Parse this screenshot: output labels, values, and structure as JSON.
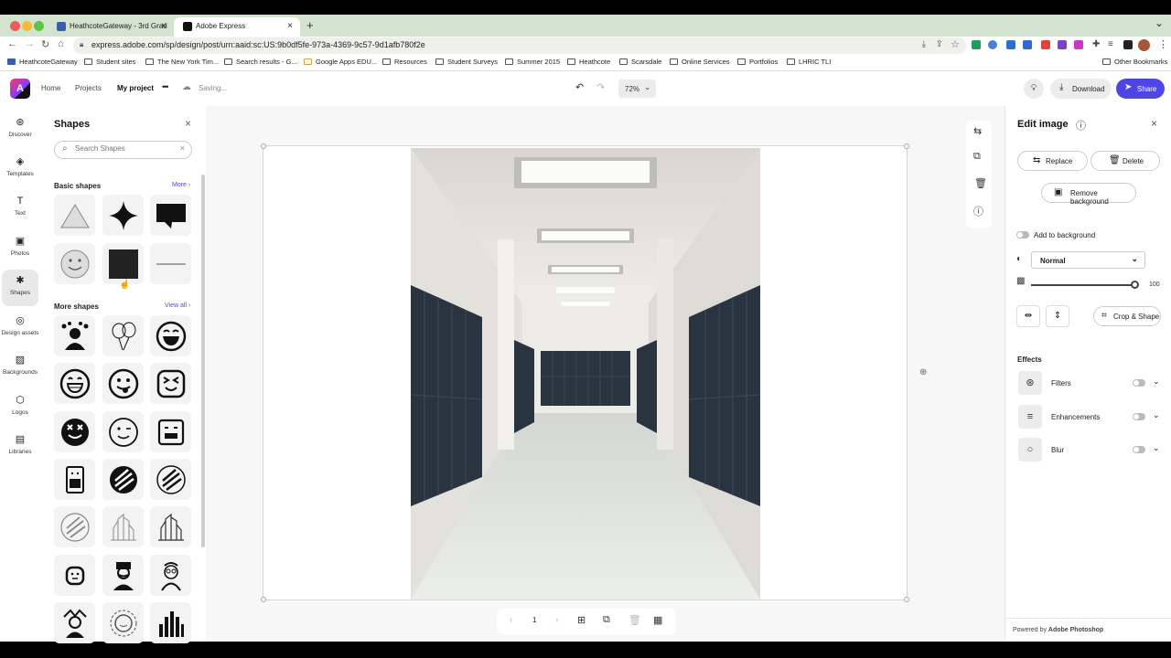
{
  "browser": {
    "tabs": [
      {
        "title": "HeathcoteGateway - 3rd Grad",
        "close": "×"
      },
      {
        "title": "Adobe Express",
        "close": "×"
      }
    ],
    "new_tab": "+",
    "url": "express.adobe.com/sp/design/post/urn:aaid:sc:US:9b0df5fe-973a-4369-9c57-9d1afb780f2e",
    "bookmarks": [
      "HeathcoteGateway",
      "Student sites",
      "The New York Tim...",
      "Search results - G...",
      "Google Apps EDU...",
      "Resources",
      "Student Surveys",
      "Summer 2015",
      "Heathcote",
      "Scarsdale",
      "Online Services",
      "Portfolios",
      "LHRIC TLI"
    ],
    "other_bookmarks": "Other Bookmarks"
  },
  "header": {
    "logo": "A",
    "breadcrumb": {
      "home": "Home",
      "projects": "Projects",
      "current": "My project"
    },
    "more": "•••",
    "status": "Saving...",
    "zoom": "72%",
    "download": "Download",
    "share": "Share"
  },
  "rail": {
    "items": [
      {
        "label": "Discover"
      },
      {
        "label": "Templates"
      },
      {
        "label": "Text"
      },
      {
        "label": "Photos"
      },
      {
        "label": "Shapes"
      },
      {
        "label": "Design assets"
      },
      {
        "label": "Backgrounds"
      },
      {
        "label": "Logos"
      },
      {
        "label": "Libraries"
      }
    ]
  },
  "shapes_panel": {
    "title": "Shapes",
    "search_placeholder": "Search Shapes",
    "basic_title": "Basic shapes",
    "basic_more": "More ›",
    "more_title": "More shapes",
    "more_view_all": "View all ›"
  },
  "page_nav": {
    "page": "1"
  },
  "edit_image": {
    "title": "Edit image",
    "replace": "Replace",
    "delete": "Delete",
    "remove_background": "Remove background",
    "add_to_background": "Add to background",
    "blend_mode": "Normal",
    "opacity": "100",
    "crop_shape": "Crop & Shape",
    "effects_title": "Effects",
    "effects": [
      {
        "label": "Filters"
      },
      {
        "label": "Enhancements"
      },
      {
        "label": "Blur"
      }
    ],
    "powered_by_prefix": "Powered by",
    "powered_by_brand": "Adobe Photoshop"
  },
  "colors": {
    "accent": "#4f45e4",
    "tabbar": "#d3e3d0",
    "lockers": "#2a3440"
  }
}
